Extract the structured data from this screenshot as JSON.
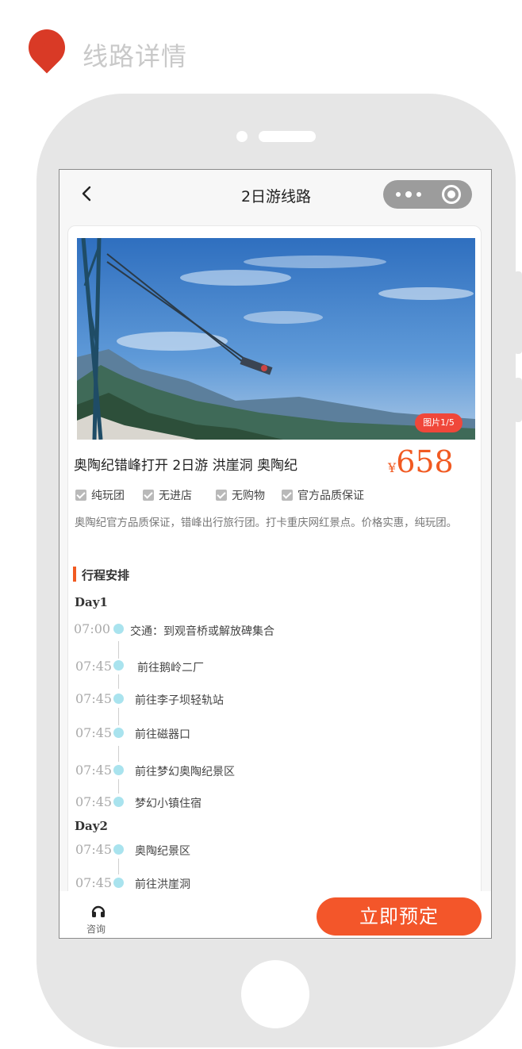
{
  "page": {
    "title": "线路详情"
  },
  "miniapp": {
    "nav_title": "2日游线路"
  },
  "product": {
    "photo_counter": "图片1/5",
    "title": "奥陶纪错峰打开  2日游  洪崖洞  奥陶纪",
    "price_currency": "¥",
    "price": "658",
    "tags": [
      "纯玩团",
      "无进店",
      "无购物",
      "官方品质保证"
    ],
    "description": "奥陶纪官方品质保证，错峰出行旅行团。打卡重庆网红景点。价格实惠，纯玩团。"
  },
  "itinerary": {
    "heading": "行程安排",
    "days": [
      {
        "label": "Day1",
        "stops": [
          {
            "time": "07:00",
            "text": "交通：到观音桥或解放碑集合"
          },
          {
            "time": "07:45",
            "text": "前往鹅岭二厂"
          },
          {
            "time": "07:45",
            "text": "前往李子坝轻轨站"
          },
          {
            "time": "07:45",
            "text": "前往磁器口"
          },
          {
            "time": "07:45",
            "text": "前往梦幻奥陶纪景区"
          },
          {
            "time": "07:45",
            "text": "梦幻小镇住宿"
          }
        ]
      },
      {
        "label": "Day2",
        "stops": [
          {
            "time": "07:45",
            "text": "奥陶纪景区"
          },
          {
            "time": "07:45",
            "text": "前往洪崖洞"
          }
        ]
      }
    ]
  },
  "bottom_bar": {
    "consult_label": "咨询",
    "book_label": "立即预定"
  },
  "colors": {
    "accent": "#f15a22",
    "pin": "#d93a26",
    "timeline_dot": "#a9e3ee",
    "badge": "#f0473a"
  },
  "icons": {
    "pin": "map-pin-icon",
    "back": "back-arrow-icon",
    "more": "more-dots-icon",
    "close": "capsule-close-icon",
    "consult": "headset-icon",
    "check": "check-icon"
  }
}
